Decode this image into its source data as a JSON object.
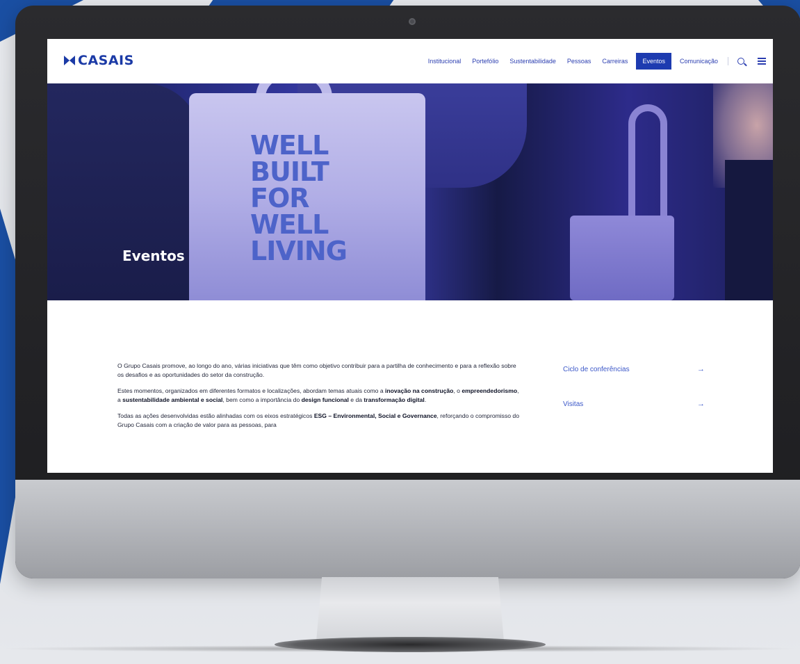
{
  "colors": {
    "brand": "#1b3aa6",
    "nav_active_bg": "#1d3bb0",
    "link": "#3b57c8"
  },
  "header": {
    "logo_text": "CASAIS",
    "nav": [
      {
        "label": "Institucional",
        "active": false
      },
      {
        "label": "Portefólio",
        "active": false
      },
      {
        "label": "Sustentabilidade",
        "active": false
      },
      {
        "label": "Pessoas",
        "active": false
      },
      {
        "label": "Carreiras",
        "active": false
      },
      {
        "label": "Eventos",
        "active": true
      },
      {
        "label": "Comunicação",
        "active": false
      }
    ],
    "search_icon": "search-icon",
    "menu_icon": "menu-icon"
  },
  "hero": {
    "title": "Eventos",
    "bag_text": [
      "WELL",
      "BUILT",
      "FOR",
      "WELL",
      "LIVING"
    ]
  },
  "content": {
    "paragraphs": [
      [
        {
          "t": "O Grupo Casais promove, ao longo do ano, várias iniciativas que têm como objetivo contribuir para a partilha de conhecimento e para a reflexão sobre os desafios e as oportunidades do setor da construção.",
          "b": false
        }
      ],
      [
        {
          "t": "Estes momentos, organizados em diferentes formatos e localizações, abordam temas atuais como a ",
          "b": false
        },
        {
          "t": "inovação na construção",
          "b": true
        },
        {
          "t": ", o ",
          "b": false
        },
        {
          "t": "empreendedorismo",
          "b": true
        },
        {
          "t": ", a ",
          "b": false
        },
        {
          "t": "sustentabilidade ambiental e social",
          "b": true
        },
        {
          "t": ", bem como a importância do ",
          "b": false
        },
        {
          "t": "design funcional",
          "b": true
        },
        {
          "t": " e da ",
          "b": false
        },
        {
          "t": "transformação digital",
          "b": true
        },
        {
          "t": ".",
          "b": false
        }
      ],
      [
        {
          "t": "Todas as ações desenvolvidas estão alinhadas com os eixos estratégicos ",
          "b": false
        },
        {
          "t": "ESG – Environmental, Social e Governance",
          "b": true
        },
        {
          "t": ", reforçando o compromisso do Grupo Casais com a criação de valor para as pessoas, para",
          "b": false
        }
      ]
    ],
    "side_links": [
      {
        "label": "Ciclo de conferências",
        "arrow": "→"
      },
      {
        "label": "Visitas",
        "arrow": "→"
      }
    ]
  }
}
